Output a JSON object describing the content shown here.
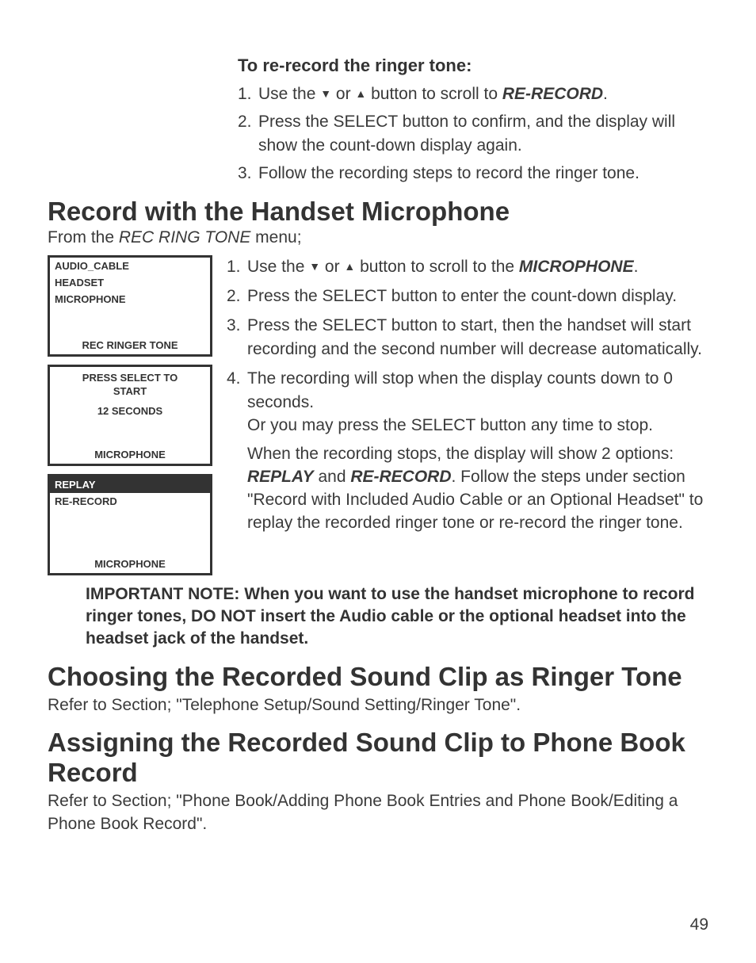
{
  "intro": {
    "heading": "To re-record the ringer tone:",
    "steps": [
      {
        "num": "1.",
        "pre": "Use the  ",
        "mid": "  or  ",
        "post": "   button to scroll to ",
        "target": "RE-RECORD",
        "end": "."
      },
      {
        "num": "2.",
        "text": "Press the SELECT button to confirm, and the display will show the count-down display again."
      },
      {
        "num": "3.",
        "text": "Follow the recording steps to record the ringer tone."
      }
    ]
  },
  "section1": {
    "title": "Record with the Handset Microphone",
    "from_pre": "From the ",
    "from_italic": "REC RING TONE",
    "from_post": " menu;",
    "screens": {
      "s1": {
        "line1": "AUDIO_CABLE",
        "line2": "HEADSET",
        "line3": "MICROPHONE",
        "footer": "REC RINGER TONE"
      },
      "s2": {
        "line1": "PRESS SELECT TO",
        "line2": "START",
        "line3": "12 SECONDS",
        "footer": "MICROPHONE"
      },
      "s3": {
        "hl": "REPLAY",
        "line2": "RE-RECORD",
        "footer": "MICROPHONE"
      }
    },
    "steps": [
      {
        "num": "1.",
        "pre": "Use the  ",
        "mid": "  or  ",
        "post": "   button to scroll to the ",
        "target": "MICROPHONE",
        "end": "."
      },
      {
        "num": "2.",
        "text": "Press the SELECT button to enter the count-down display."
      },
      {
        "num": "3.",
        "text": "Press the SELECT button to start, then the handset will start recording and the second number will decrease automatically."
      },
      {
        "num": "4.",
        "text_a": "The recording will stop when the display counts down to 0 seconds.",
        "text_b": "Or you may press the SELECT button any time to stop."
      }
    ],
    "after_pre": "When the recording stops, the display will show 2 options: ",
    "after_b1": "REPLAY",
    "after_mid": " and ",
    "after_b2": "RE-RECORD",
    "after_post": ". Follow the steps under section \"Record with Included Audio Cable or an Optional Headset\" to replay the recorded ringer tone or re-record the ringer tone."
  },
  "important": "IMPORTANT NOTE: When you want to use the handset microphone to record ringer tones, DO NOT insert the Audio cable or the optional headset into the headset jack of the handset.",
  "section2": {
    "title": "Choosing the Recorded Sound Clip as Ringer Tone",
    "refer": "Refer to Section; \"Telephone Setup/Sound Setting/Ringer Tone\"."
  },
  "section3": {
    "title": "Assigning the Recorded Sound Clip to Phone Book Record",
    "refer": "Refer to Section; \"Phone Book/Adding Phone Book Entries and Phone Book/Editing a Phone Book Record\"."
  },
  "page": "49",
  "arrows": {
    "down": "▼",
    "up": "▲"
  }
}
